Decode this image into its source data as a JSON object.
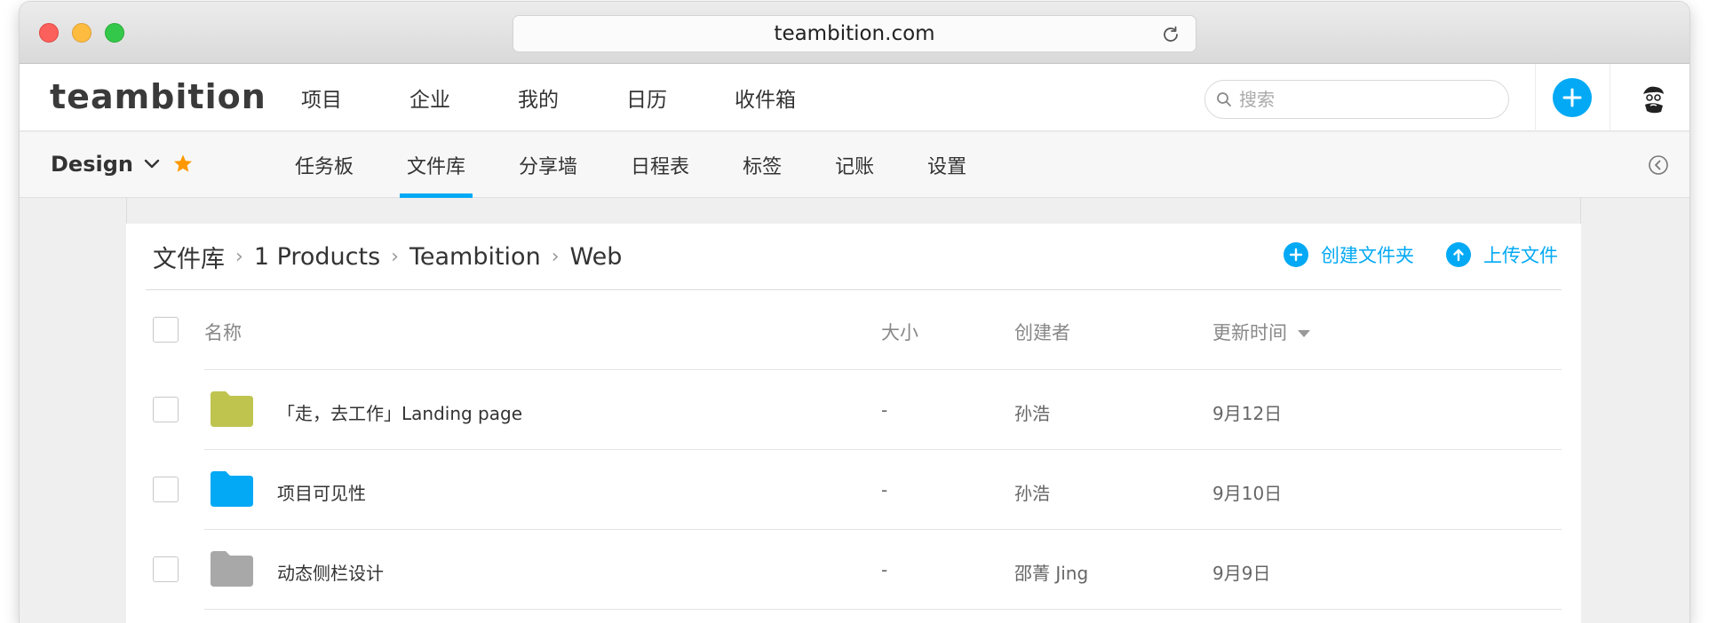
{
  "browser": {
    "url": "teambition.com"
  },
  "topnav": {
    "logo": "teambition",
    "links": [
      "项目",
      "企业",
      "我的",
      "日历",
      "收件箱"
    ],
    "search_placeholder": "搜索"
  },
  "project": {
    "name": "Design",
    "tabs": [
      "任务板",
      "文件库",
      "分享墙",
      "日程表",
      "标签",
      "记账",
      "设置"
    ],
    "active_tab": "文件库"
  },
  "breadcrumb": [
    "文件库",
    "1 Products",
    "Teambition",
    "Web"
  ],
  "actions": {
    "create_folder": "创建文件夹",
    "upload_file": "上传文件"
  },
  "table": {
    "headers": {
      "name": "名称",
      "size": "大小",
      "creator": "创建者",
      "updated": "更新时间"
    },
    "rows": [
      {
        "name": "「走，去工作」Landing page",
        "size": "-",
        "creator": "孙浩",
        "updated": "9月12日",
        "folder_color": "#bfc44f"
      },
      {
        "name": "项目可见性",
        "size": "-",
        "creator": "孙浩",
        "updated": "9月10日",
        "folder_color": "#03a9f4"
      },
      {
        "name": "动态侧栏设计",
        "size": "-",
        "creator": "邵菁 Jing",
        "updated": "9月9日",
        "folder_color": "#a8a8a8"
      }
    ]
  },
  "colors": {
    "accent": "#03a9f4"
  }
}
